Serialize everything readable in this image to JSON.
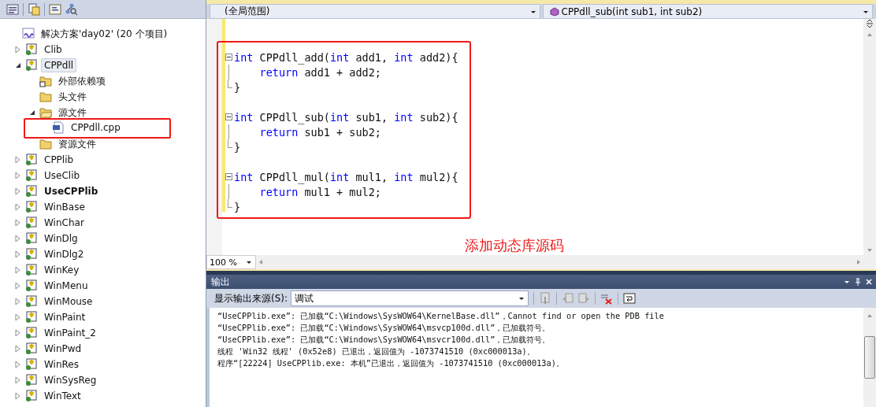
{
  "solution_explorer": {
    "tree": [
      {
        "label": "解决方案'day02' (20 个项目)",
        "kind": "solution",
        "children": [
          {
            "label": "Clib",
            "kind": "project",
            "expanded": false,
            "selected": false,
            "startup": false
          },
          {
            "label": "CPPdll",
            "kind": "project",
            "expanded": true,
            "selected": true,
            "startup": false,
            "children": [
              {
                "label": "外部依赖项",
                "kind": "external"
              },
              {
                "label": "头文件",
                "kind": "folder"
              },
              {
                "label": "源文件",
                "kind": "folder",
                "expanded": true,
                "children": [
                  {
                    "label": "CPPdll.cpp",
                    "kind": "file",
                    "highlighted": true
                  }
                ]
              },
              {
                "label": "资源文件",
                "kind": "folder"
              }
            ]
          },
          {
            "label": "CPPlib",
            "kind": "project",
            "expanded": false,
            "selected": false,
            "startup": false
          },
          {
            "label": "UseClib",
            "kind": "project",
            "expanded": false,
            "selected": false,
            "startup": false
          },
          {
            "label": "UseCPPlib",
            "kind": "project",
            "expanded": false,
            "selected": false,
            "startup": true
          },
          {
            "label": "WinBase",
            "kind": "project",
            "expanded": false,
            "selected": false,
            "startup": false
          },
          {
            "label": "WinChar",
            "kind": "project",
            "expanded": false,
            "selected": false,
            "startup": false
          },
          {
            "label": "WinDlg",
            "kind": "project",
            "expanded": false,
            "selected": false,
            "startup": false
          },
          {
            "label": "WinDlg2",
            "kind": "project",
            "expanded": false,
            "selected": false,
            "startup": false
          },
          {
            "label": "WinKey",
            "kind": "project",
            "expanded": false,
            "selected": false,
            "startup": false
          },
          {
            "label": "WinMenu",
            "kind": "project",
            "expanded": false,
            "selected": false,
            "startup": false
          },
          {
            "label": "WinMouse",
            "kind": "project",
            "expanded": false,
            "selected": false,
            "startup": false
          },
          {
            "label": "WinPaint",
            "kind": "project",
            "expanded": false,
            "selected": false,
            "startup": false
          },
          {
            "label": "WinPaint_2",
            "kind": "project",
            "expanded": false,
            "selected": false,
            "startup": false
          },
          {
            "label": "WinPwd",
            "kind": "project",
            "expanded": false,
            "selected": false,
            "startup": false
          },
          {
            "label": "WinRes",
            "kind": "project",
            "expanded": false,
            "selected": false,
            "startup": false
          },
          {
            "label": "WinSysReg",
            "kind": "project",
            "expanded": false,
            "selected": false,
            "startup": false
          },
          {
            "label": "WinText",
            "kind": "project",
            "expanded": false,
            "selected": false,
            "startup": false
          }
        ]
      }
    ]
  },
  "editor": {
    "scope": "(全局范围)",
    "member": "CPPdll_sub(int sub1, int sub2)",
    "zoom": "100 %",
    "annotation": "添加动态库源码",
    "lines": [
      {
        "kind": "header",
        "tokens": [
          {
            "t": "int",
            "kind": "keyword"
          },
          {
            "t": " CPPdll_add(",
            "kind": "plain"
          },
          {
            "t": "int",
            "kind": "keyword"
          },
          {
            "t": " add1, ",
            "kind": "plain"
          },
          {
            "t": "int",
            "kind": "keyword"
          },
          {
            "t": " add2){",
            "kind": "plain"
          }
        ]
      },
      {
        "kind": "body",
        "tokens": [
          {
            "t": "return",
            "kind": "keyword"
          },
          {
            "t": " add1 + add2;",
            "kind": "plain"
          }
        ]
      },
      {
        "kind": "closer",
        "tokens": [
          {
            "t": "}",
            "kind": "plain"
          }
        ]
      },
      {
        "kind": "blank"
      },
      {
        "kind": "header",
        "tokens": [
          {
            "t": "int",
            "kind": "keyword"
          },
          {
            "t": " CPPdll_sub(",
            "kind": "plain"
          },
          {
            "t": "int",
            "kind": "keyword"
          },
          {
            "t": " sub1, ",
            "kind": "plain"
          },
          {
            "t": "int",
            "kind": "keyword"
          },
          {
            "t": " sub2){",
            "kind": "plain"
          }
        ]
      },
      {
        "kind": "body",
        "tokens": [
          {
            "t": "return",
            "kind": "keyword"
          },
          {
            "t": " sub1 + sub2;",
            "kind": "plain"
          }
        ]
      },
      {
        "kind": "closer",
        "tokens": [
          {
            "t": "}",
            "kind": "plain"
          }
        ]
      },
      {
        "kind": "blank"
      },
      {
        "kind": "header",
        "tokens": [
          {
            "t": "int",
            "kind": "keyword"
          },
          {
            "t": " CPPdll_mul(",
            "kind": "plain"
          },
          {
            "t": "int",
            "kind": "keyword"
          },
          {
            "t": " mul1, ",
            "kind": "plain"
          },
          {
            "t": "int",
            "kind": "keyword"
          },
          {
            "t": " mul2){",
            "kind": "plain"
          }
        ]
      },
      {
        "kind": "body",
        "tokens": [
          {
            "t": "return",
            "kind": "keyword"
          },
          {
            "t": " mul1 + mul2;",
            "kind": "plain"
          }
        ]
      },
      {
        "kind": "closer",
        "tokens": [
          {
            "t": "}",
            "kind": "plain"
          }
        ]
      }
    ]
  },
  "output": {
    "title": "输出",
    "source_label": "显示输出来源(S):",
    "source": "调试",
    "lines": [
      "“UseCPPlib.exe”: 已加载“C:\\Windows\\SysWOW64\\KernelBase.dll”，Cannot find or open the PDB file",
      "“UseCPPlib.exe”: 已加载“C:\\Windows\\SysWOW64\\msvcp100d.dll”，已加载符号。",
      "“UseCPPlib.exe”: 已加载“C:\\Windows\\SysWOW64\\msvcr100d.dll”，已加载符号。",
      "线程 'Win32 线程' (0x52e8) 已退出，返回值为 -1073741510 (0xc000013a)。",
      "程序“[22224] UseCPPlib.exe: 本机”已退出，返回值为 -1073741510 (0xc000013a)。"
    ]
  }
}
